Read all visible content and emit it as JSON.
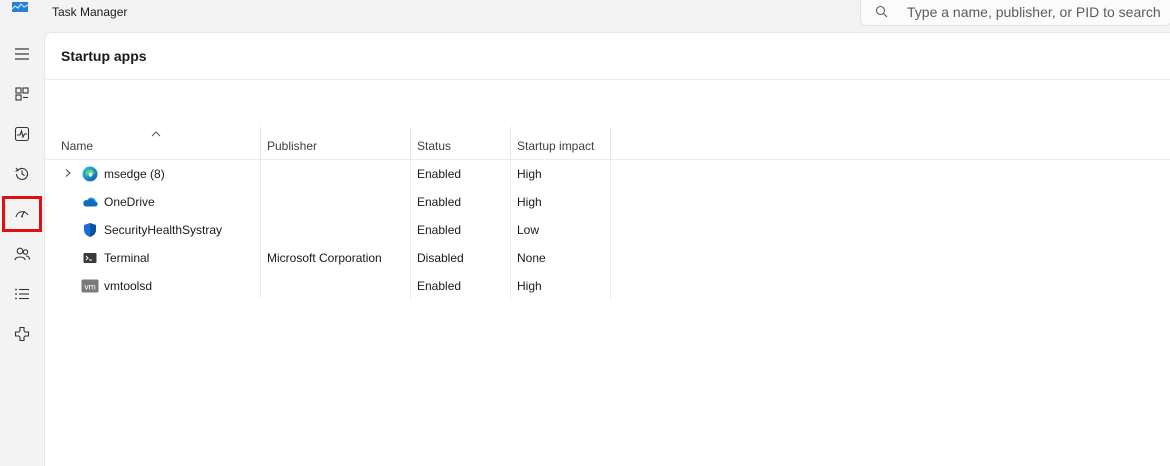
{
  "window": {
    "title": "Task Manager"
  },
  "search": {
    "placeholder": "Type a name, publisher, or PID to search",
    "value": ""
  },
  "nav": {
    "items": [
      {
        "icon": "hamburger-menu-icon"
      },
      {
        "icon": "processes-icon"
      },
      {
        "icon": "performance-icon"
      },
      {
        "icon": "app-history-icon"
      },
      {
        "icon": "startup-apps-icon",
        "selected": true
      },
      {
        "icon": "users-icon"
      },
      {
        "icon": "details-icon"
      },
      {
        "icon": "services-icon"
      }
    ],
    "highlight_color": "#e01010"
  },
  "page": {
    "title": "Startup apps"
  },
  "table": {
    "columns": [
      "Name",
      "Publisher",
      "Status",
      "Startup impact"
    ],
    "rows": [
      {
        "name": "msedge (8)",
        "publisher": "",
        "status": "Enabled",
        "impact": "High",
        "icon": "edge-icon",
        "expandable": true
      },
      {
        "name": "OneDrive",
        "publisher": "",
        "status": "Enabled",
        "impact": "High",
        "icon": "onedrive-icon",
        "expandable": false
      },
      {
        "name": "SecurityHealthSystray",
        "publisher": "",
        "status": "Enabled",
        "impact": "Low",
        "icon": "security-shield-icon",
        "expandable": false
      },
      {
        "name": "Terminal",
        "publisher": "Microsoft Corporation",
        "status": "Disabled",
        "impact": "None",
        "icon": "terminal-icon",
        "expandable": false
      },
      {
        "name": "vmtoolsd",
        "publisher": "",
        "status": "Enabled",
        "impact": "High",
        "icon": "vmware-icon",
        "expandable": false
      }
    ]
  }
}
